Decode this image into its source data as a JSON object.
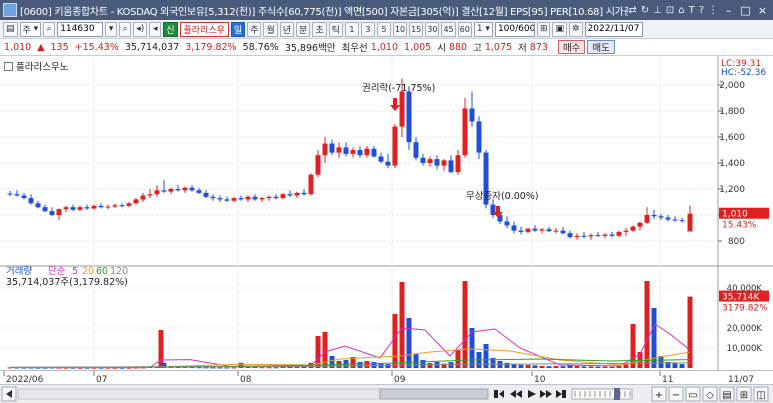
{
  "titlebar": {
    "title": "[0600] 키움종합차트 - KOSDAQ 외국인보유[5,312(천)] 주식수[60,775(천)] 액면[500] 자본금[305(억)] 결산[12월] EPS[95] PER[10.68] 시가총액[614(억"
  },
  "toolbar": {
    "period_select": "주",
    "code": "114630",
    "badge_new": "신",
    "stock_name": "플라리스우",
    "tabs": [
      "일",
      "주",
      "월",
      "년",
      "분",
      "초",
      "틱"
    ],
    "active_tab": "일",
    "minutes": [
      "1",
      "3",
      "5",
      "10",
      "15",
      "30",
      "45",
      "60"
    ],
    "count_select": "1",
    "count": "100/600",
    "date": "2022/11/07"
  },
  "quote": {
    "price": "1,010",
    "change": "135",
    "change_pct": "+15.43%",
    "volume": "35,714,037",
    "volume_pct": "3,179.82%",
    "turnover": "58.76%",
    "amount": "35,896백만",
    "best_label": "최우선",
    "best_ask": "1,010",
    "best_bid": "1,005",
    "open_label": "시",
    "open": "880",
    "high_label": "고",
    "high": "1,075",
    "low_label": "저",
    "low": "873",
    "buy_label": "매수",
    "sell_label": "매도"
  },
  "chart": {
    "name": "플라리스우노",
    "lc": "LC:39.31",
    "hc": "HC:-52.36",
    "annotation_rights": "권리락(-71.75%)",
    "annotation_bonus": "무상증자(0.00%)",
    "price_axis": [
      "2,000",
      "1,800",
      "1,600",
      "1,400",
      "1,200",
      "1,000",
      "800"
    ],
    "current_price_tag": "1,010",
    "current_pct_tag": "15.43%",
    "volume_title": "거래량",
    "volume_ma_label": "단순",
    "volume_ma": [
      "5",
      "20",
      "60",
      "120"
    ],
    "volume_summary": "35,714,037주(3,179.82%)",
    "volume_axis": [
      "40,000K",
      "20,000K",
      "10,000K"
    ],
    "volume_tag": "35,714K",
    "volume_pct_tag": "3179.82%",
    "date_labels": [
      "2022/06",
      "07",
      "08",
      "09",
      "10",
      "11"
    ],
    "last_date": "11/07",
    "colors": {
      "up": "#e02020",
      "down": "#1f4fd8",
      "ma5": "#d030d0",
      "ma20": "#e8a020",
      "ma60": "#30a030",
      "ma120": "#888888"
    }
  }
}
